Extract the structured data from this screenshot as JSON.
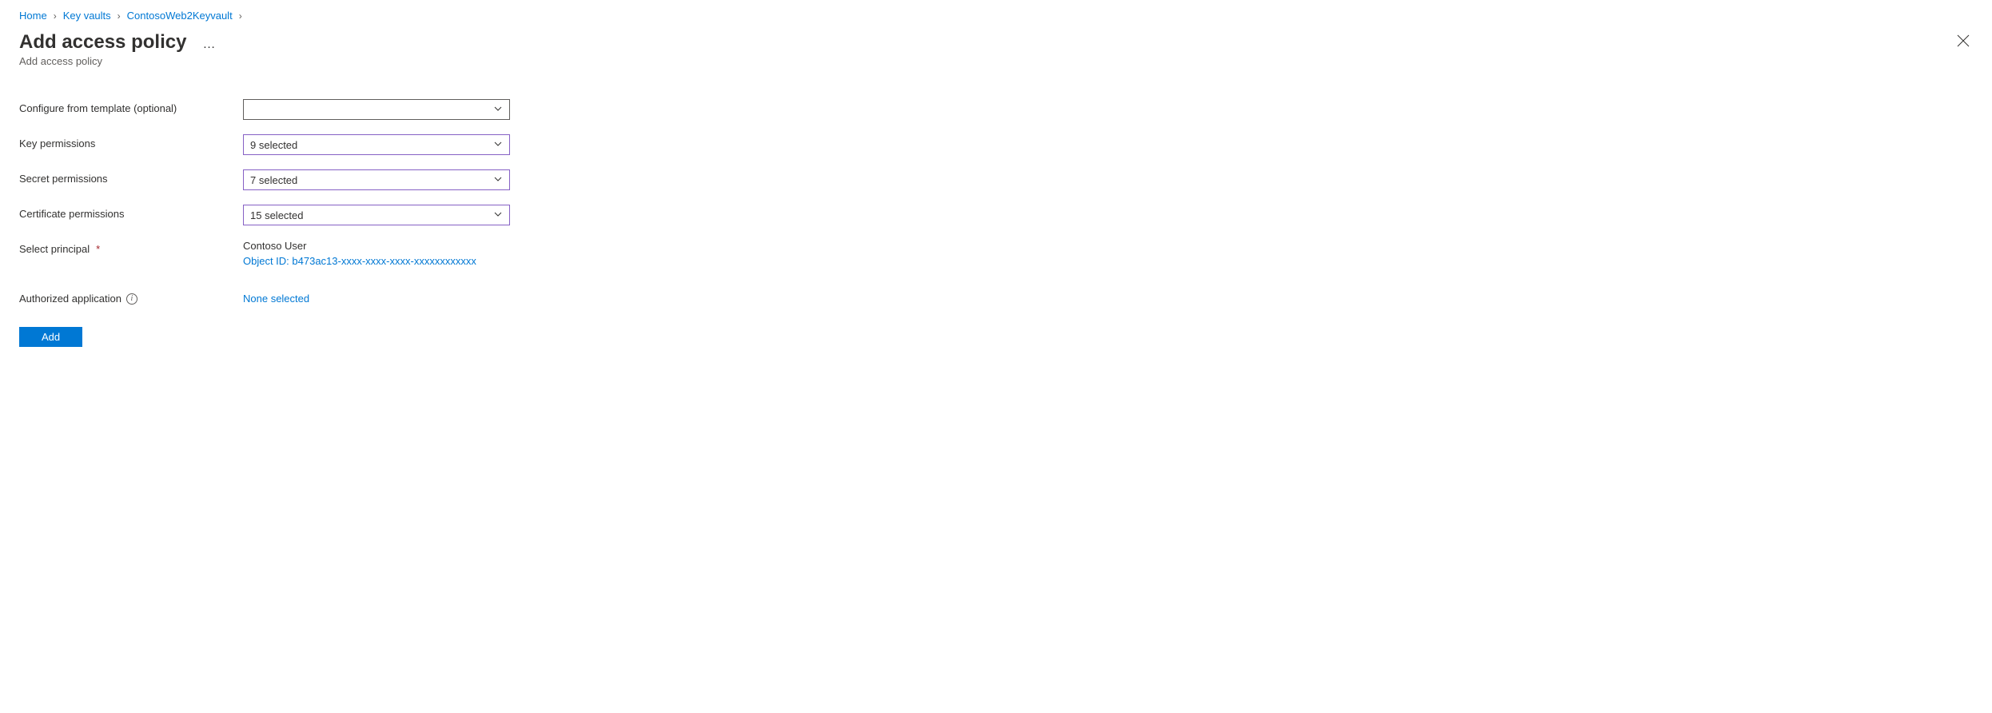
{
  "breadcrumb": {
    "items": [
      "Home",
      "Key vaults",
      "ContosoWeb2Keyvault"
    ]
  },
  "header": {
    "title": "Add access policy",
    "subtitle": "Add access policy"
  },
  "form": {
    "template": {
      "label": "Configure from template (optional)",
      "value": ""
    },
    "key_permissions": {
      "label": "Key permissions",
      "value": "9 selected"
    },
    "secret_permissions": {
      "label": "Secret permissions",
      "value": "7 selected"
    },
    "certificate_permissions": {
      "label": "Certificate permissions",
      "value": "15 selected"
    },
    "principal": {
      "label": "Select principal",
      "name": "Contoso User",
      "object_id": "Object ID: b473ac13-xxxx-xxxx-xxxx-xxxxxxxxxxxx"
    },
    "authorized_app": {
      "label": "Authorized application",
      "value": "None selected"
    }
  },
  "buttons": {
    "add": "Add"
  }
}
